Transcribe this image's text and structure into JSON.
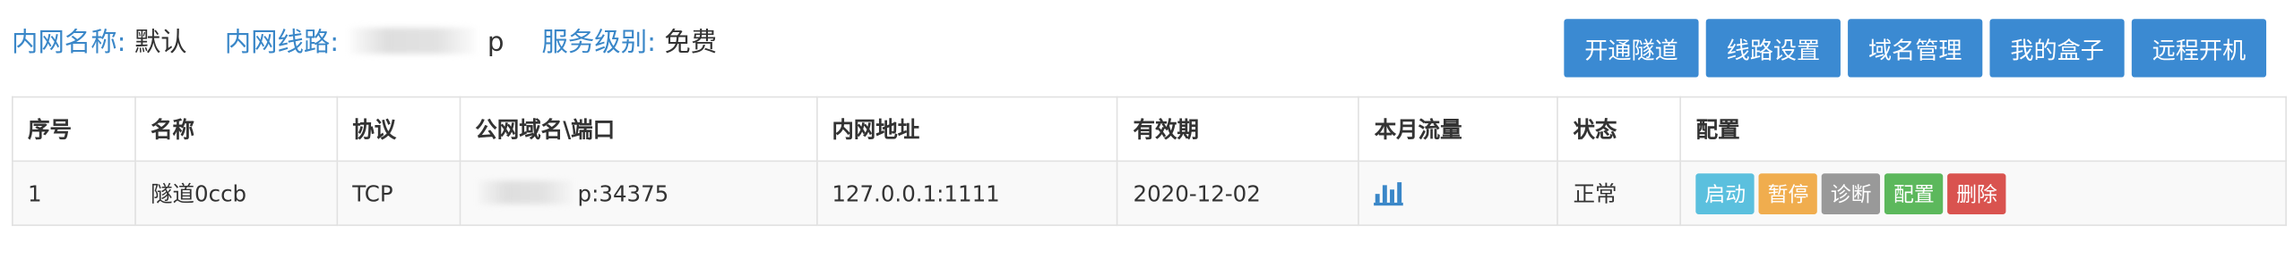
{
  "info": {
    "name_label": "内网名称:",
    "name_value": "默认",
    "line_label": "内网线路:",
    "line_value": "p",
    "service_label": "服务级别:",
    "service_value": "免费"
  },
  "toolbar": {
    "buttons": [
      {
        "label": "开通隧道"
      },
      {
        "label": "线路设置"
      },
      {
        "label": "域名管理"
      },
      {
        "label": "我的盒子"
      },
      {
        "label": "远程开机"
      }
    ]
  },
  "table": {
    "headers": [
      "序号",
      "名称",
      "协议",
      "公网域名\\端口",
      "内网地址",
      "有效期",
      "本月流量",
      "状态",
      "配置"
    ],
    "rows": [
      {
        "index": "1",
        "name": "隧道0ccb",
        "protocol": "TCP",
        "public_addr": "p:34375",
        "local_addr": "127.0.0.1:1111",
        "expiry": "2020-12-02",
        "traffic_icon": "bar-chart-icon",
        "status": "正常",
        "actions": [
          {
            "label": "启动",
            "color": "#5bc0de"
          },
          {
            "label": "暂停",
            "color": "#f0ad4e"
          },
          {
            "label": "诊断",
            "color": "#999999"
          },
          {
            "label": "配置",
            "color": "#5cb85c"
          },
          {
            "label": "删除",
            "color": "#d9534f"
          }
        ]
      }
    ]
  },
  "colors": {
    "accent_text": "#3a87c8",
    "primary_button": "#3b8ad2",
    "start": "#5bc0de",
    "pause": "#f0ad4e",
    "diagnose": "#999999",
    "config": "#5cb85c",
    "delete": "#d9534f"
  }
}
